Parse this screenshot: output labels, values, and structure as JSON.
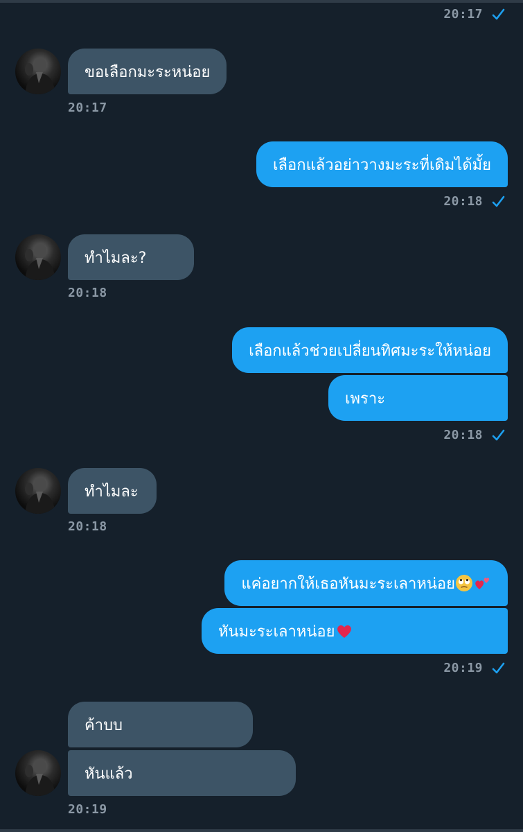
{
  "messages": [
    {
      "from": "me",
      "time": "20:17"
    },
    {
      "from": "them",
      "text": "ขอเลือกมะระหน่อย",
      "time": "20:17"
    },
    {
      "from": "me",
      "text": "เลือกแล้วอย่าวางมะระที่เดิมได้มั้ย",
      "time": "20:18"
    },
    {
      "from": "them",
      "text": "ทำไมละ?",
      "time": "20:18"
    },
    {
      "from": "me",
      "text": "เลือกแล้วช่วยเปลี่ยนทิศมะระให้หน่อย"
    },
    {
      "from": "me",
      "text": "เพราะ",
      "time": "20:18"
    },
    {
      "from": "them",
      "text": "ทำไมละ",
      "time": "20:18"
    },
    {
      "from": "me",
      "text": "แค่อยากให้เธอหันมะระเลาหน่อย",
      "emoji": [
        "face-with-rolling-eyes",
        "two-hearts"
      ]
    },
    {
      "from": "me",
      "text": "หันมะระเลาหน่อย",
      "emoji": [
        "red-heart"
      ],
      "time": "20:19"
    },
    {
      "from": "them",
      "text": "ค้าบบ"
    },
    {
      "from": "them",
      "text": "หันแล้ว",
      "time": "20:19"
    }
  ],
  "icons": {
    "read_check": "check-icon",
    "avatar": "avatar-photo"
  },
  "colors": {
    "background": "#15202b",
    "incoming_bubble": "#3d5466",
    "outgoing_bubble": "#1da1f2",
    "timestamp": "#8b98a5",
    "check": "#1da1f2"
  }
}
